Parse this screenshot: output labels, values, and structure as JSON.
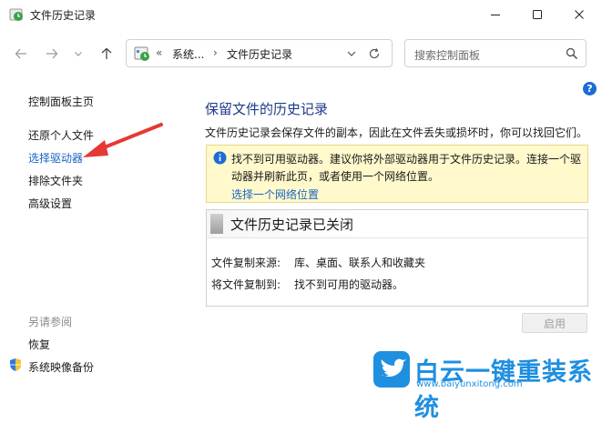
{
  "window": {
    "title": "文件历史记录"
  },
  "address": {
    "overflow": "«",
    "crumb1": "系统...",
    "sep": "›",
    "crumb2": "文件历史记录"
  },
  "search": {
    "placeholder": "搜索控制面板"
  },
  "left": {
    "home": "控制面板主页",
    "restore": "还原个人文件",
    "select_drive": "选择驱动器",
    "exclude": "排除文件夹",
    "advanced": "高级设置",
    "see_also": "另请参阅",
    "recovery": "恢复",
    "system_image": "系统映像备份"
  },
  "main": {
    "heading": "保留文件的历史记录",
    "desc": "文件历史记录会保存文件的副本，因此在文件丢失或损坏时，你可以找回它们。",
    "alert": {
      "text": "找不到可用驱动器。建议你将外部驱动器用于文件历史记录。连接一个驱动器并刷新此页，或者使用一个网络位置。",
      "link": "选择一个网络位置"
    },
    "status": {
      "title": "文件历史记录已关闭",
      "copy_from_label": "文件复制来源:",
      "copy_from_value": "库、桌面、联系人和收藏夹",
      "copy_to_label": "将文件复制到:",
      "copy_to_value": "找不到可用的驱动器。"
    },
    "enable_button": "启用"
  },
  "watermark": {
    "text": "白云一键重装系统",
    "url": "www.baiyunxitong.com"
  },
  "colors": {
    "heading": "#1e3a8a",
    "link": "#1a64c4",
    "alert_bg": "#fff9cc",
    "arrow": "#e53935"
  }
}
